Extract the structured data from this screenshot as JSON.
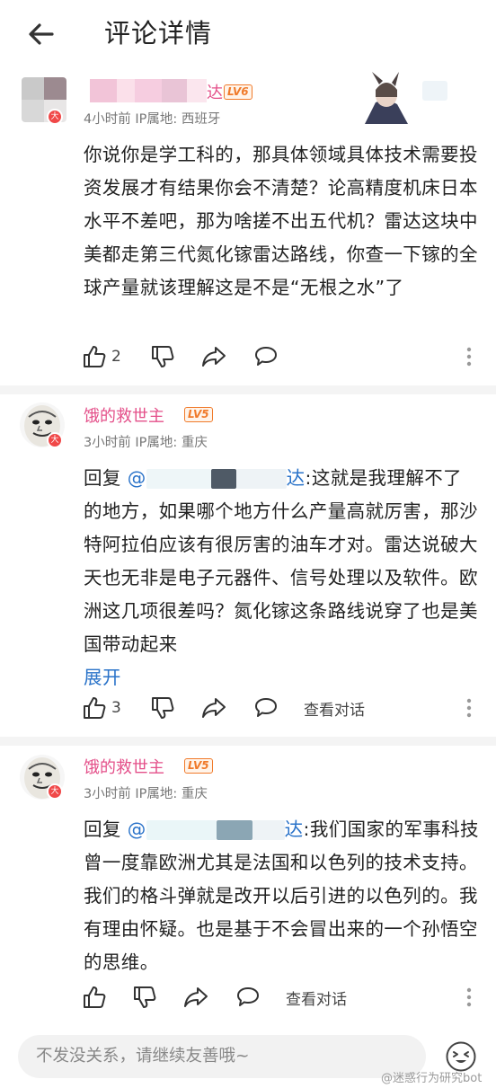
{
  "header": {
    "title": "评论详情"
  },
  "comments": [
    {
      "username": "达",
      "level": "LV6",
      "time": "4小时前",
      "ip_label": "IP属地:",
      "ip": "西班牙",
      "body": "你说你是学工科的，那具体领域具体技术需要投资发展才有结果你会不清楚？论高精度机床日本水平不差吧，那为啥搓不出五代机？雷达这块中美都走第三代氮化镓雷达路线，你查一下镓的全球产量就该理解这是不是“无根之水”了",
      "likes": "2"
    },
    {
      "username": "饿的救世主",
      "level": "LV5",
      "time": "3小时前",
      "ip_label": "IP属地:",
      "ip": "重庆",
      "reply_prefix": "回复",
      "mention_at": "@",
      "mention_tail": "达",
      "body": ":这就是我理解不了的地方，如果哪个地方什么产量高就厉害，那沙特阿拉伯应该有很厉害的油车才对。雷达说破大天也无非是电子元器件、信号处理以及软件。欧洲这几项很差吗？氮化镓这条路线说穿了也是美国带动起来",
      "expand": "展开",
      "likes": "3",
      "view_conversation": "查看对话"
    },
    {
      "username": "饿的救世主",
      "level": "LV5",
      "time": "3小时前",
      "ip_label": "IP属地:",
      "ip": "重庆",
      "reply_prefix": "回复",
      "mention_at": "@",
      "mention_tail": "达",
      "body": ":我们国家的军事科技曾一度靠欧洲尤其是法国和以色列的技术支持。我们的格斗弹就是改开以后引进的以色列的。我有理由怀疑。也是基于不会冒出来的一个孙悟空的思维。",
      "view_conversation": "查看对话"
    }
  ],
  "badge_text": "大",
  "input": {
    "placeholder": "不发没关系，请继续友善哦~"
  },
  "watermark": "@迷惑行为研究bot",
  "colors": {
    "username": "#e4508a",
    "level": "#f07a2a",
    "link": "#2a73c9",
    "badge": "#f04848"
  }
}
